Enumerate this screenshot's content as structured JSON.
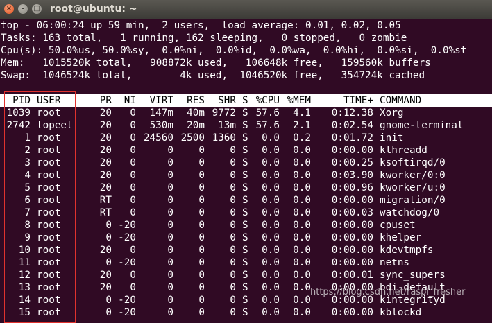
{
  "window": {
    "title": "root@ubuntu: ~",
    "close_glyph": "×",
    "min_glyph": "–",
    "max_glyph": "□"
  },
  "summary": [
    "top - 06:00:24 up 59 min,  2 users,  load average: 0.01, 0.02, 0.05",
    "Tasks: 163 total,   1 running, 162 sleeping,   0 stopped,   0 zombie",
    "Cpu(s): 50.0%us, 50.0%sy,  0.0%ni,  0.0%id,  0.0%wa,  0.0%hi,  0.0%si,  0.0%st",
    "Mem:   1015520k total,   908872k used,   106648k free,   159560k buffers",
    "Swap:  1046524k total,        4k used,  1046520k free,   354724k cached"
  ],
  "columns": [
    "PID",
    "USER",
    "PR",
    "NI",
    "VIRT",
    "RES",
    "SHR",
    "S",
    "%CPU",
    "%MEM",
    "TIME+",
    "COMMAND"
  ],
  "processes": [
    [
      "1039",
      "root",
      "20",
      "0",
      "147m",
      "40m",
      "9772",
      "S",
      "57.6",
      "4.1",
      "0:12.38",
      "Xorg"
    ],
    [
      "2742",
      "topeet",
      "20",
      "0",
      "530m",
      "20m",
      "13m",
      "S",
      "57.6",
      "2.1",
      "0:02.54",
      "gnome-terminal"
    ],
    [
      "1",
      "root",
      "20",
      "0",
      "24560",
      "2500",
      "1360",
      "S",
      "0.0",
      "0.2",
      "0:01.72",
      "init"
    ],
    [
      "2",
      "root",
      "20",
      "0",
      "0",
      "0",
      "0",
      "S",
      "0.0",
      "0.0",
      "0:00.00",
      "kthreadd"
    ],
    [
      "3",
      "root",
      "20",
      "0",
      "0",
      "0",
      "0",
      "S",
      "0.0",
      "0.0",
      "0:00.25",
      "ksoftirqd/0"
    ],
    [
      "4",
      "root",
      "20",
      "0",
      "0",
      "0",
      "0",
      "S",
      "0.0",
      "0.0",
      "0:03.90",
      "kworker/0:0"
    ],
    [
      "5",
      "root",
      "20",
      "0",
      "0",
      "0",
      "0",
      "S",
      "0.0",
      "0.0",
      "0:00.96",
      "kworker/u:0"
    ],
    [
      "6",
      "root",
      "RT",
      "0",
      "0",
      "0",
      "0",
      "S",
      "0.0",
      "0.0",
      "0:00.00",
      "migration/0"
    ],
    [
      "7",
      "root",
      "RT",
      "0",
      "0",
      "0",
      "0",
      "S",
      "0.0",
      "0.0",
      "0:00.03",
      "watchdog/0"
    ],
    [
      "8",
      "root",
      "0",
      "-20",
      "0",
      "0",
      "0",
      "S",
      "0.0",
      "0.0",
      "0:00.00",
      "cpuset"
    ],
    [
      "9",
      "root",
      "0",
      "-20",
      "0",
      "0",
      "0",
      "S",
      "0.0",
      "0.0",
      "0:00.00",
      "khelper"
    ],
    [
      "10",
      "root",
      "20",
      "0",
      "0",
      "0",
      "0",
      "S",
      "0.0",
      "0.0",
      "0:00.00",
      "kdevtmpfs"
    ],
    [
      "11",
      "root",
      "0",
      "-20",
      "0",
      "0",
      "0",
      "S",
      "0.0",
      "0.0",
      "0:00.00",
      "netns"
    ],
    [
      "12",
      "root",
      "20",
      "0",
      "0",
      "0",
      "0",
      "S",
      "0.0",
      "0.0",
      "0:00.01",
      "sync_supers"
    ],
    [
      "13",
      "root",
      "20",
      "0",
      "0",
      "0",
      "0",
      "S",
      "0.0",
      "0.0",
      "0:00.00",
      "bdi-default"
    ],
    [
      "14",
      "root",
      "0",
      "-20",
      "0",
      "0",
      "0",
      "S",
      "0.0",
      "0.0",
      "0:00.00",
      "kintegrityd"
    ],
    [
      "15",
      "root",
      "0",
      "-20",
      "0",
      "0",
      "0",
      "S",
      "0.0",
      "0.0",
      "0:00.00",
      "kblockd"
    ]
  ],
  "watermark": "https://blog.csdn.net/raspi_fresher",
  "colors": {
    "background": "#300a24",
    "text": "#ffffff",
    "header_bg": "#ffffff",
    "highlight_box": "#e0322e"
  }
}
